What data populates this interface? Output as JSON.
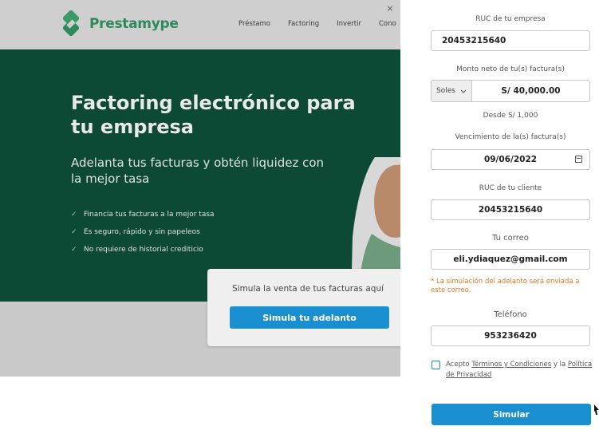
{
  "brand": {
    "name": "Prestamype",
    "color": "#2f8a5b"
  },
  "nav": {
    "items": [
      "Préstamo",
      "Factoring",
      "Invertir",
      "Cono"
    ],
    "close_symbol": "×"
  },
  "hero": {
    "title": "Factoring electrónico para tu empresa",
    "subtitle": "Adelanta tus facturas y obtén liquidez con la mejor tasa",
    "bullets": [
      "Financia tus facturas a la mejor tasa",
      "Es seguro, rápido y sin papeleos",
      "No requiere de historial crediticio"
    ],
    "bullet_icon": "check-icon",
    "background": "#0d4a36"
  },
  "sim_card": {
    "text": "Simula la venta de tus facturas aquí",
    "button": "Simula tu adelanto"
  },
  "form": {
    "ruc_empresa": {
      "label": "RUC de tu empresa",
      "value": "20453215640"
    },
    "monto": {
      "label": "Monto neto de tu(s) factura(s)",
      "currency": "Soles",
      "value": "S/ 40,000.00",
      "hint": "Desde S/ 1,000"
    },
    "vencimiento": {
      "label": "Vencimiento de la(s) factura(s)",
      "value": "09/06/2022"
    },
    "ruc_cliente": {
      "label": "RUC de tu cliente",
      "value": "20453215640"
    },
    "correo": {
      "label": "Tu correo",
      "value": "eli.ydiaquez@gmail.com",
      "note": "* La simulación del adelanto será enviada a este correo."
    },
    "telefono": {
      "label": "Teléfono",
      "value": "953236420"
    },
    "terms": {
      "prefix": "Acepto ",
      "terminos": "Términos y Condiciones",
      "middle": " y la ",
      "privacidad": "Política de Privacidad"
    },
    "submit": "Simular"
  },
  "colors": {
    "accent": "#1a8fd0",
    "warning": "#e07a1f",
    "nav_bg": "#cfcfcf"
  }
}
